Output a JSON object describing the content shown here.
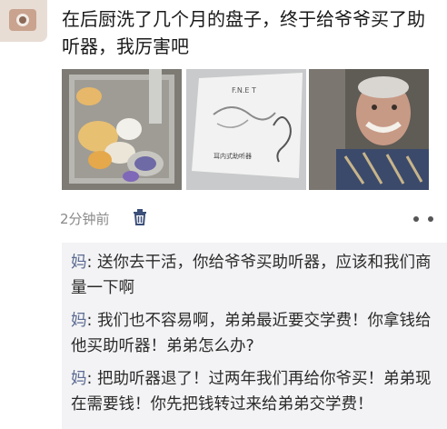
{
  "post": {
    "text": "在后厨洗了几个月的盘子，终于给爷爷买了助听器，我厉害吧",
    "time": "2分钟前"
  },
  "photos": [
    {
      "name": "kitchen-sink-photo"
    },
    {
      "name": "hearing-aid-box-photo",
      "box_label": "耳内式助听器"
    },
    {
      "name": "grandpa-photo"
    }
  ],
  "comments": [
    {
      "name": "妈",
      "sep": ": ",
      "text": "送你去干活，你给爷爷买助听器，应该和我们商量一下啊"
    },
    {
      "name": "妈",
      "sep": ": ",
      "text": "我们也不容易啊，弟弟最近要交学费！你拿钱给他买助听器！弟弟怎么办?"
    },
    {
      "name": "妈",
      "sep": ": ",
      "text": "把助听器退了！过两年我们再给你爷买！弟弟现在需要钱！你先把钱转过来给弟弟交学费！"
    }
  ],
  "icons": {
    "trash": "trash-icon",
    "more": "more-icon"
  },
  "colors": {
    "name_link": "#5b6b92",
    "comment_bg": "#f3f3f5",
    "meta": "#8a8a8a"
  }
}
